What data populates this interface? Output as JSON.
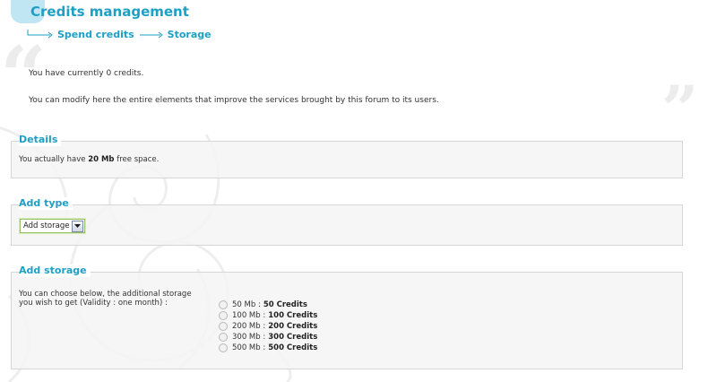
{
  "header": {
    "title": "Credits management",
    "breadcrumb": [
      "Spend credits",
      "Storage"
    ]
  },
  "intro": {
    "credits_text": "You have currently 0 credits.",
    "description": "You can modify here the entire elements that improve the services brought by this forum to its users."
  },
  "details": {
    "title": "Details",
    "text_before": "You actually have ",
    "space_value": "20 Mb",
    "text_after": " free space."
  },
  "add_type": {
    "title": "Add type",
    "selected": "Add storage"
  },
  "add_storage": {
    "title": "Add storage",
    "instructions_line1": "You can choose below, the additional storage",
    "instructions_line2": "you wish to get (Validity : one month) :",
    "options": [
      {
        "size": "50 Mb",
        "credits": "50 Credits"
      },
      {
        "size": "100 Mb",
        "credits": "100 Credits"
      },
      {
        "size": "200 Mb",
        "credits": "200 Credits"
      },
      {
        "size": "300 Mb",
        "credits": "300 Credits"
      },
      {
        "size": "500 Mb",
        "credits": "500 Credits"
      }
    ]
  },
  "colors": {
    "accent": "#1e9fc4",
    "panel_bg": "#f4f4f4",
    "panel_border": "#d6d6d6"
  }
}
